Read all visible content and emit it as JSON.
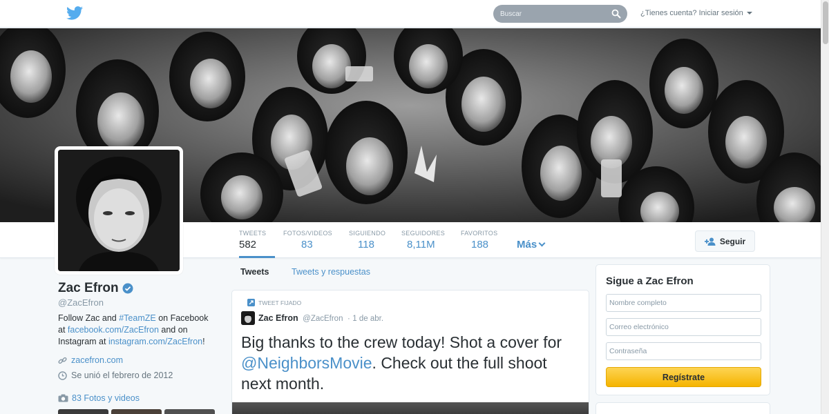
{
  "topbar": {
    "search_placeholder": "Buscar",
    "login_text": "¿Tienes cuenta? Iniciar sesión"
  },
  "profile": {
    "name": "Zac Efron",
    "handle": "@ZacEfron",
    "bio": {
      "p1": "Follow Zac and ",
      "hashtag": "#TeamZE",
      "p2": " on Facebook at ",
      "fb_link": "facebook.com/ZacEfron",
      "p3": " and on Instagram at ",
      "ig_link": "instagram.com/ZacEfron",
      "p4": "!"
    },
    "website": "zacefron.com",
    "joined": "Se unió el febrero de 2012",
    "photos_link": "83 Fotos y videos"
  },
  "stats": [
    {
      "label": "Tweets",
      "value": "582"
    },
    {
      "label": "Fotos/videos",
      "value": "83"
    },
    {
      "label": "Siguiendo",
      "value": "118"
    },
    {
      "label": "Seguidores",
      "value": "8,11M"
    },
    {
      "label": "Favoritos",
      "value": "188"
    }
  ],
  "more_label": "Más",
  "follow_label": "Seguir",
  "timeline_tabs": [
    "Tweets",
    "Tweets y respuestas"
  ],
  "tweet": {
    "pinned_label": "TWEET FIJADO",
    "name": "Zac Efron",
    "handle": "@ZacEfron",
    "date": "1 de abr.",
    "text_a": "Big thanks to the crew today! Shot a cover for ",
    "mention": "@NeighborsMovie",
    "text_b": ". Check out the full shoot next month."
  },
  "signup": {
    "title": "Sigue a Zac Efron",
    "name_placeholder": "Nombre completo",
    "email_placeholder": "Correo electrónico",
    "password_placeholder": "Contraseña",
    "button_label": "Regístrate"
  },
  "colors": {
    "accent": "#4a90c9",
    "signup_button": "#f5b400"
  }
}
